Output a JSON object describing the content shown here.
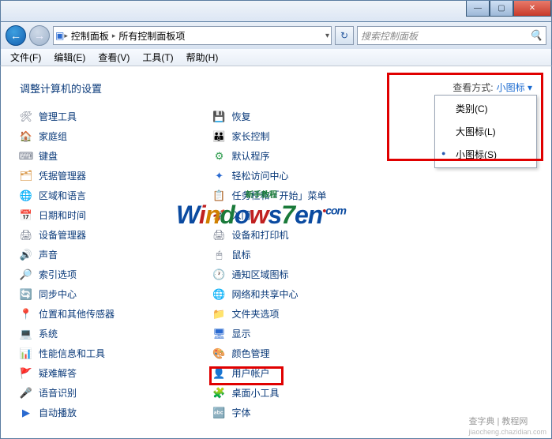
{
  "window": {
    "min": "—",
    "max": "▢",
    "close": "✕"
  },
  "nav": {
    "crumb_icon": "▸",
    "crumb1": "控制面板",
    "crumb2": "所有控制面板项",
    "refresh": "↻"
  },
  "search": {
    "placeholder": "搜索控制面板",
    "icon": "🔍"
  },
  "menu": {
    "file": "文件(F)",
    "edit": "编辑(E)",
    "view": "查看(V)",
    "tools": "工具(T)",
    "help": "帮助(H)"
  },
  "heading": "调整计算机的设置",
  "viewby": {
    "label": "查看方式:",
    "value": "小图标 ▾"
  },
  "dropdown": {
    "opt1": "类别(C)",
    "opt2": "大图标(L)",
    "opt3": "小图标(S)"
  },
  "col1": [
    {
      "icon": "🛠",
      "cls": "ic-gray",
      "label": "管理工具"
    },
    {
      "icon": "🏠",
      "cls": "ic-green",
      "label": "家庭组"
    },
    {
      "icon": "⌨",
      "cls": "ic-gray",
      "label": "键盘"
    },
    {
      "icon": "🗂",
      "cls": "ic-orange",
      "label": "凭据管理器"
    },
    {
      "icon": "🌐",
      "cls": "ic-blue",
      "label": "区域和语言"
    },
    {
      "icon": "📅",
      "cls": "ic-blue",
      "label": "日期和时间"
    },
    {
      "icon": "🖨",
      "cls": "ic-gray",
      "label": "设备管理器"
    },
    {
      "icon": "🔊",
      "cls": "ic-gray",
      "label": "声音"
    },
    {
      "icon": "🔎",
      "cls": "ic-orange",
      "label": "索引选项"
    },
    {
      "icon": "🔄",
      "cls": "ic-green",
      "label": "同步中心"
    },
    {
      "icon": "📍",
      "cls": "ic-blue",
      "label": "位置和其他传感器"
    },
    {
      "icon": "💻",
      "cls": "ic-blue",
      "label": "系统"
    },
    {
      "icon": "📊",
      "cls": "ic-blue",
      "label": "性能信息和工具"
    },
    {
      "icon": "🚩",
      "cls": "ic-blue",
      "label": "疑难解答"
    },
    {
      "icon": "🎤",
      "cls": "ic-gray",
      "label": "语音识别"
    },
    {
      "icon": "▶",
      "cls": "ic-blue",
      "label": "自动播放"
    }
  ],
  "col2": [
    {
      "icon": "💾",
      "cls": "ic-blue",
      "label": "恢复"
    },
    {
      "icon": "👪",
      "cls": "ic-orange",
      "label": "家长控制"
    },
    {
      "icon": "⚙",
      "cls": "ic-green",
      "label": "默认程序"
    },
    {
      "icon": "✦",
      "cls": "ic-blue",
      "label": "轻松访问中心"
    },
    {
      "icon": "📋",
      "cls": "ic-blue",
      "label": "任务栏和「开始」菜单"
    },
    {
      "icon": "🚀",
      "cls": "ic-blue",
      "label": "入门"
    },
    {
      "icon": "🖨",
      "cls": "ic-gray",
      "label": "设备和打印机"
    },
    {
      "icon": "🖱",
      "cls": "ic-gray",
      "label": "鼠标"
    },
    {
      "icon": "🕐",
      "cls": "ic-blue",
      "label": "通知区域图标"
    },
    {
      "icon": "🌐",
      "cls": "ic-blue",
      "label": "网络和共享中心"
    },
    {
      "icon": "📁",
      "cls": "ic-orange",
      "label": "文件夹选项"
    },
    {
      "icon": "🖥",
      "cls": "ic-blue",
      "label": "显示"
    },
    {
      "icon": "🎨",
      "cls": "ic-purple",
      "label": "颜色管理"
    },
    {
      "icon": "👤",
      "cls": "ic-green",
      "label": "用户帐户"
    },
    {
      "icon": "🧩",
      "cls": "ic-orange",
      "label": "桌面小工具"
    },
    {
      "icon": "🔤",
      "cls": "ic-blue",
      "label": "字体"
    }
  ],
  "watermark": {
    "sub": "新手教程",
    "footer1": "查字典 | 教程网",
    "footer2": "jiaocheng.chazidian.com"
  }
}
